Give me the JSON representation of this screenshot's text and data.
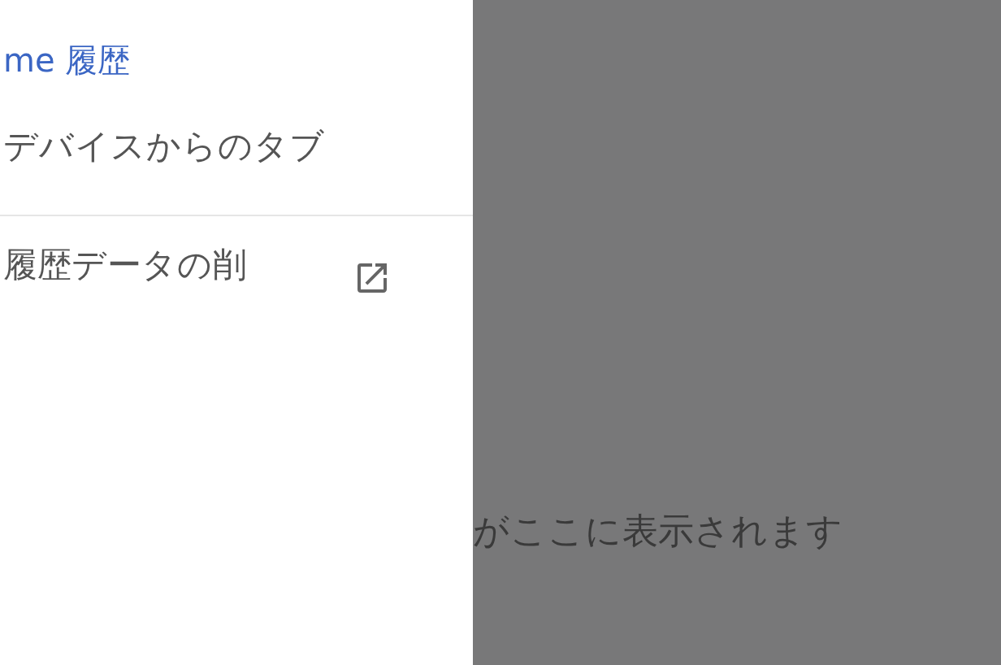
{
  "drawer": {
    "title": "me 履歴",
    "items": [
      {
        "label": "デバイスからのタブ",
        "kind": "plain"
      },
      {
        "label": "履歴データの削",
        "kind": "external"
      }
    ]
  },
  "content": {
    "message": "がここに表示されます"
  }
}
